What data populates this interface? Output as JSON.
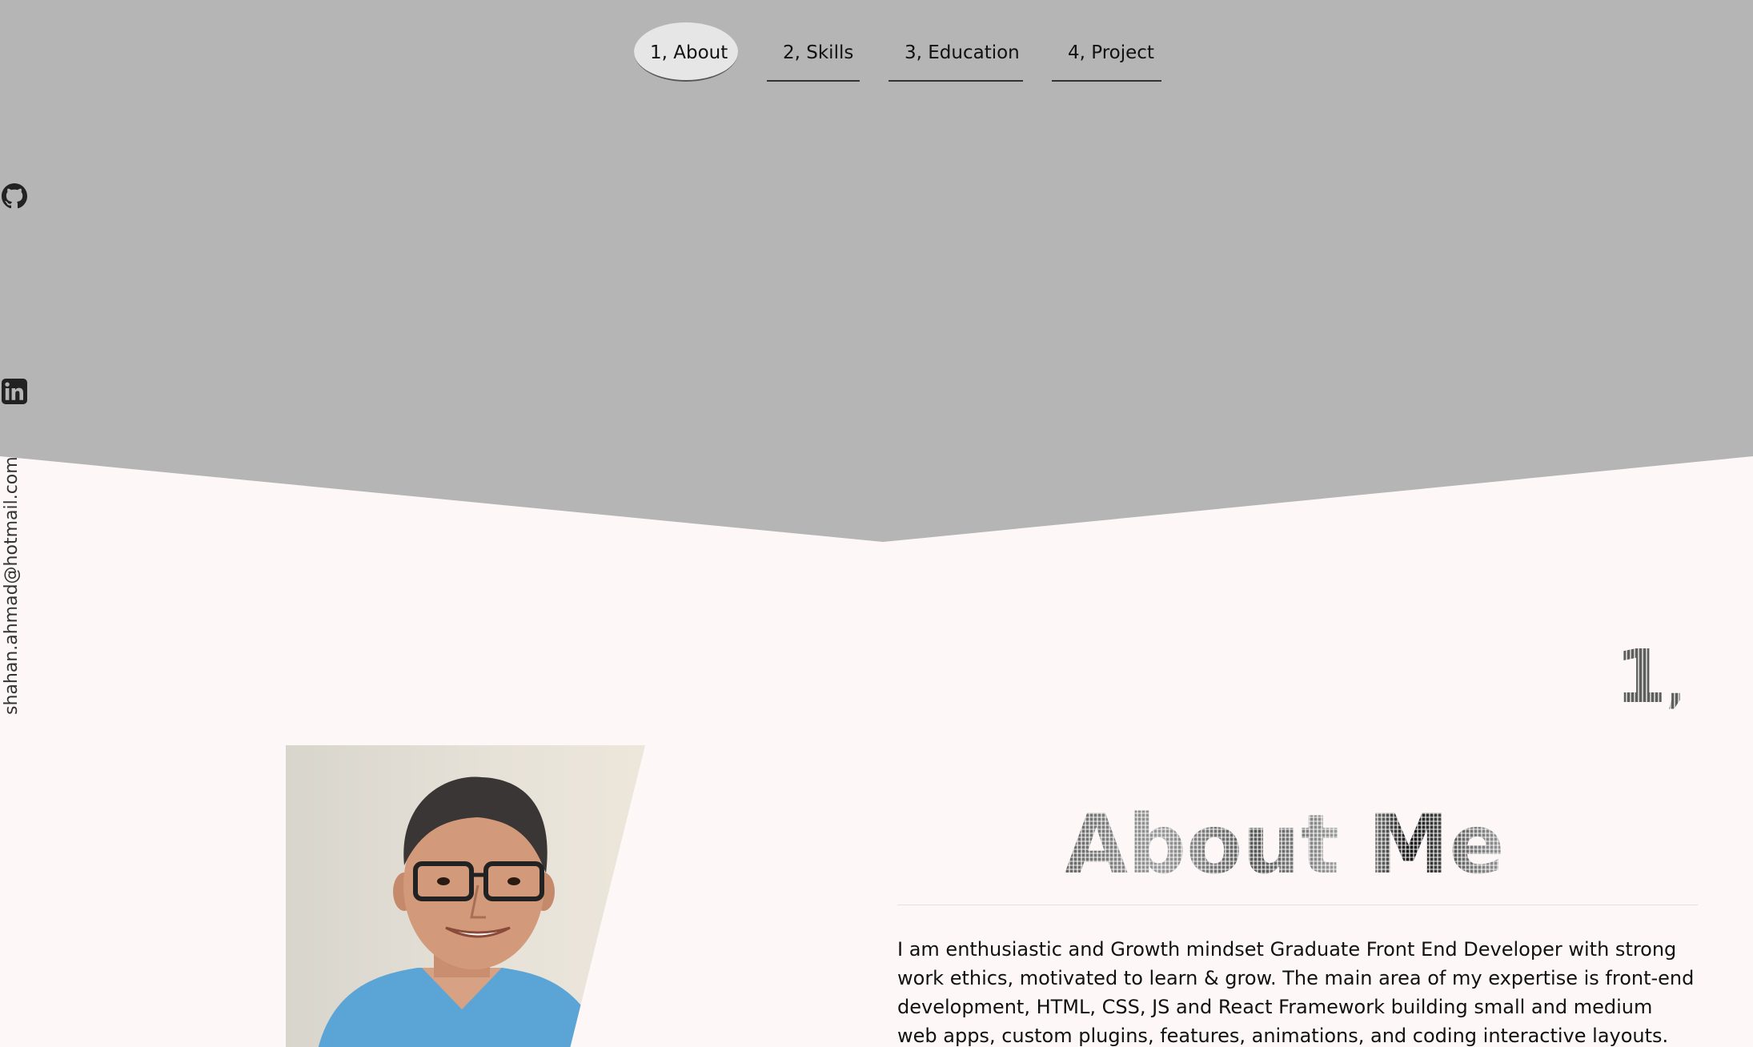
{
  "nav": {
    "items": [
      {
        "label": "1, About",
        "active": true
      },
      {
        "label": "2, Skills",
        "active": false
      },
      {
        "label": "3, Education",
        "active": false
      },
      {
        "label": "4, Project",
        "active": false
      }
    ]
  },
  "social": {
    "icons": [
      "github-icon",
      "linkedin-icon"
    ],
    "email": "shahan.ahmad@hotmail.com"
  },
  "about": {
    "section_number": "1",
    "section_comma": ",",
    "title": "About Me",
    "description": "I am enthusiastic and Growth mindset Graduate Front End Developer with strong work ethics, motivated to learn & grow. The main area of my expertise is front-end development, HTML, CSS, JS and React Framework building small and medium web apps, custom plugins, features, animations, and coding interactive layouts."
  },
  "colors": {
    "header_bg": "#b5b5b5",
    "page_bg": "#fdf8f7",
    "active_pill": "#e6e6e6",
    "text": "#111111"
  }
}
